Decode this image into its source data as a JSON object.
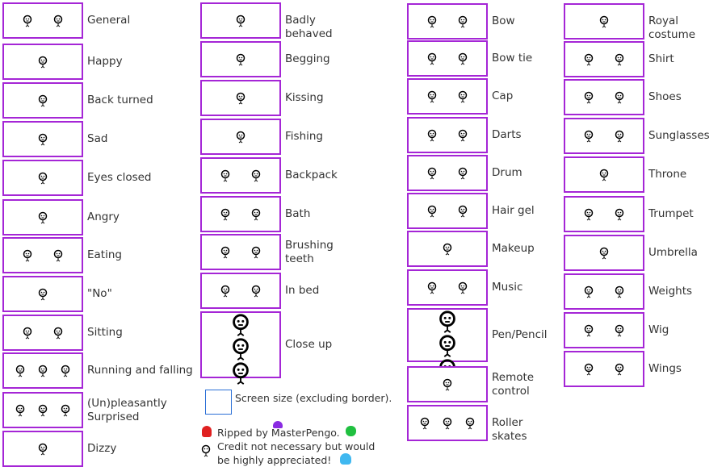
{
  "columns": [
    [
      {
        "label": "General",
        "sprites": 2
      },
      {
        "label": "Happy",
        "sprites": 1
      },
      {
        "label": "Back turned",
        "sprites": 1
      },
      {
        "label": "Sad",
        "sprites": 1
      },
      {
        "label": "Eyes closed",
        "sprites": 1
      },
      {
        "label": "Angry",
        "sprites": 1
      },
      {
        "label": "Eating",
        "sprites": 2
      },
      {
        "label": "\"No\"",
        "sprites": 1
      },
      {
        "label": "Sitting",
        "sprites": 2
      },
      {
        "label": "Running and falling",
        "sprites": 3
      },
      {
        "label": "(Un)pleasantly Surprised",
        "sprites": 3
      },
      {
        "label": "Dizzy",
        "sprites": 1
      }
    ],
    [
      {
        "label": "Badly behaved",
        "sprites": 1
      },
      {
        "label": "Begging",
        "sprites": 1
      },
      {
        "label": "Kissing",
        "sprites": 1
      },
      {
        "label": "Fishing",
        "sprites": 1
      },
      {
        "label": "Backpack",
        "sprites": 2
      },
      {
        "label": "Bath",
        "sprites": 2
      },
      {
        "label": "Brushing teeth",
        "sprites": 2
      },
      {
        "label": "In bed",
        "sprites": 2
      },
      {
        "label": "Close up",
        "sprites": 3
      }
    ],
    [
      {
        "label": "Bow",
        "sprites": 2
      },
      {
        "label": "Bow tie",
        "sprites": 2
      },
      {
        "label": "Cap",
        "sprites": 2
      },
      {
        "label": "Darts",
        "sprites": 2
      },
      {
        "label": "Drum",
        "sprites": 2
      },
      {
        "label": "Hair gel",
        "sprites": 2
      },
      {
        "label": "Makeup",
        "sprites": 1
      },
      {
        "label": "Music",
        "sprites": 2
      },
      {
        "label": "Pen/Pencil",
        "sprites": 3
      },
      {
        "label": "Remote control",
        "sprites": 1
      },
      {
        "label": "Roller skates",
        "sprites": 3
      }
    ],
    [
      {
        "label": "Royal costume",
        "sprites": 1
      },
      {
        "label": "Shirt",
        "sprites": 2
      },
      {
        "label": "Shoes",
        "sprites": 2
      },
      {
        "label": "Sunglasses",
        "sprites": 2
      },
      {
        "label": "Throne",
        "sprites": 1
      },
      {
        "label": "Trumpet",
        "sprites": 2
      },
      {
        "label": "Umbrella",
        "sprites": 1
      },
      {
        "label": "Weights",
        "sprites": 2
      },
      {
        "label": "Wig",
        "sprites": 2
      },
      {
        "label": "Wings",
        "sprites": 2
      }
    ]
  ],
  "legend": {
    "screen_size": "Screen size (excluding border).",
    "credit_line1": "Ripped by MasterPengo.",
    "credit_line2": "Credit not necessary but would",
    "credit_line3": "be highly appreciated!"
  },
  "colors": {
    "border": "#a526d6",
    "screen_box": "#2a6fd6"
  }
}
